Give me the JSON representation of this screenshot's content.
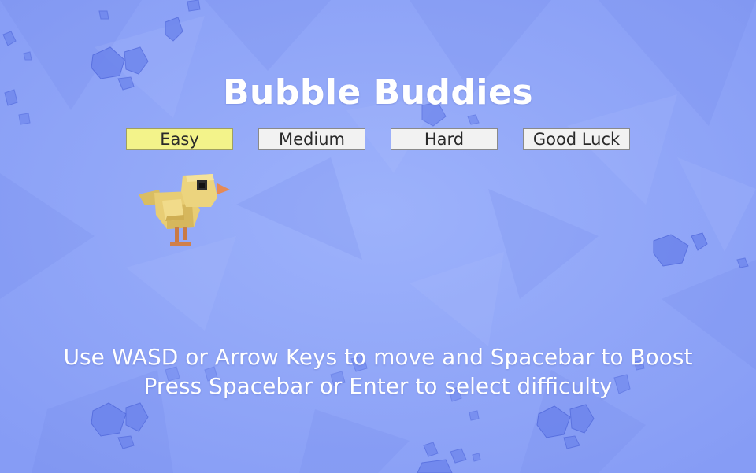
{
  "game": {
    "title": "Bubble Buddies",
    "difficulty_options": [
      {
        "label": "Easy",
        "selected": true
      },
      {
        "label": "Medium",
        "selected": false
      },
      {
        "label": "Hard",
        "selected": false
      },
      {
        "label": "Good Luck",
        "selected": false
      }
    ],
    "instructions": [
      "Use WASD or Arrow Keys to move and Spacebar to Boost",
      "Press Spacebar or Enter to select difficulty"
    ]
  },
  "colors": {
    "background": "#8fa5f8",
    "selected_button": "#f3f38a",
    "button": "#f2f2f2",
    "title_text": "#ffffff",
    "chick_body": "#e8cd74",
    "chick_beak": "#e68a55"
  },
  "icons": {
    "player_character": "yellow-chick",
    "decorations": "blue-crystal-rocks"
  }
}
